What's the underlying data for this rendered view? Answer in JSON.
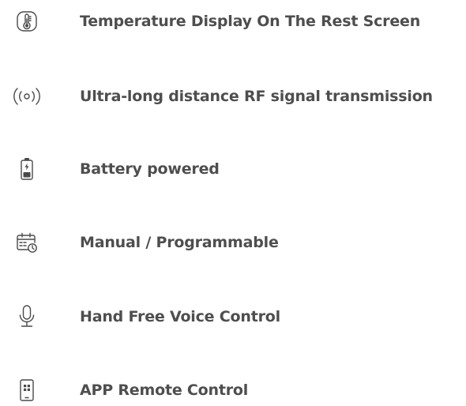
{
  "features": [
    {
      "icon": "thermometer-icon",
      "label": "Temperature Display On The Rest Screen"
    },
    {
      "icon": "rf-signal-icon",
      "label": "Ultra-long distance RF signal transmission"
    },
    {
      "icon": "battery-icon",
      "label": "Battery powered"
    },
    {
      "icon": "calendar-clock-icon",
      "label": "Manual / Programmable"
    },
    {
      "icon": "microphone-icon",
      "label": "Hand Free Voice Control"
    },
    {
      "icon": "phone-app-icon",
      "label": "APP Remote Control"
    }
  ],
  "colors": {
    "text": "#4e4e4e",
    "icon": "#4a4a4a",
    "background": "#ffffff"
  }
}
